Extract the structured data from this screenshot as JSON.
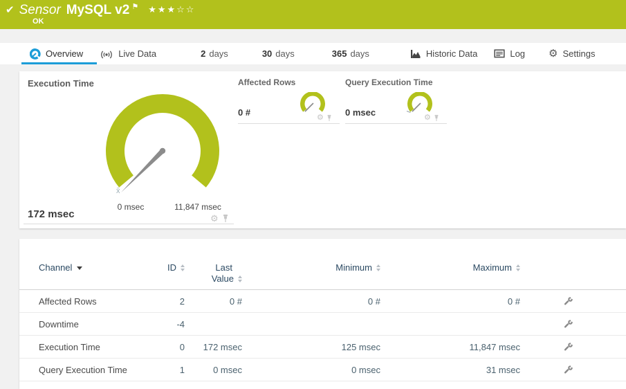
{
  "colors": {
    "header_green": "#b2c11c",
    "accent_blue": "#1c9dd8",
    "gauge_green": "#b2c11c",
    "needle_gray": "#8c8c8c"
  },
  "header": {
    "type_label": "Sensor",
    "name": "MySQL v2",
    "status": "OK",
    "stars_filled": "★★★",
    "stars_empty": "☆☆"
  },
  "tabs": [
    {
      "label": "Overview"
    },
    {
      "label": "Live Data"
    },
    {
      "num": "2",
      "label": "days"
    },
    {
      "num": "30",
      "label": "days"
    },
    {
      "num": "365",
      "label": "days"
    },
    {
      "label": "Historic Data"
    },
    {
      "label": "Log"
    },
    {
      "label": "Settings"
    }
  ],
  "gauges": {
    "execution_time": {
      "title": "Execution Time",
      "value": "172 msec",
      "scale_min": "0 msec",
      "scale_max": "11,847 msec",
      "avg_marker": "x̄"
    },
    "affected_rows": {
      "title": "Affected Rows",
      "value": "0 #"
    },
    "query_execution_time": {
      "title": "Query Execution Time",
      "value": "0 msec"
    }
  },
  "table": {
    "headers": {
      "channel": "Channel",
      "id": "ID",
      "last_line1": "Last",
      "last_line2": "Value",
      "minimum": "Minimum",
      "maximum": "Maximum"
    },
    "rows": [
      {
        "channel": "Affected Rows",
        "id": "2",
        "last": "0 #",
        "min": "0 #",
        "max": "0 #"
      },
      {
        "channel": "Downtime",
        "id": "-4",
        "last": "",
        "min": "",
        "max": ""
      },
      {
        "channel": "Execution Time",
        "id": "0",
        "last": "172 msec",
        "min": "125 msec",
        "max": "11,847 msec"
      },
      {
        "channel": "Query Execution Time",
        "id": "1",
        "last": "0 msec",
        "min": "0 msec",
        "max": "31 msec"
      }
    ]
  }
}
